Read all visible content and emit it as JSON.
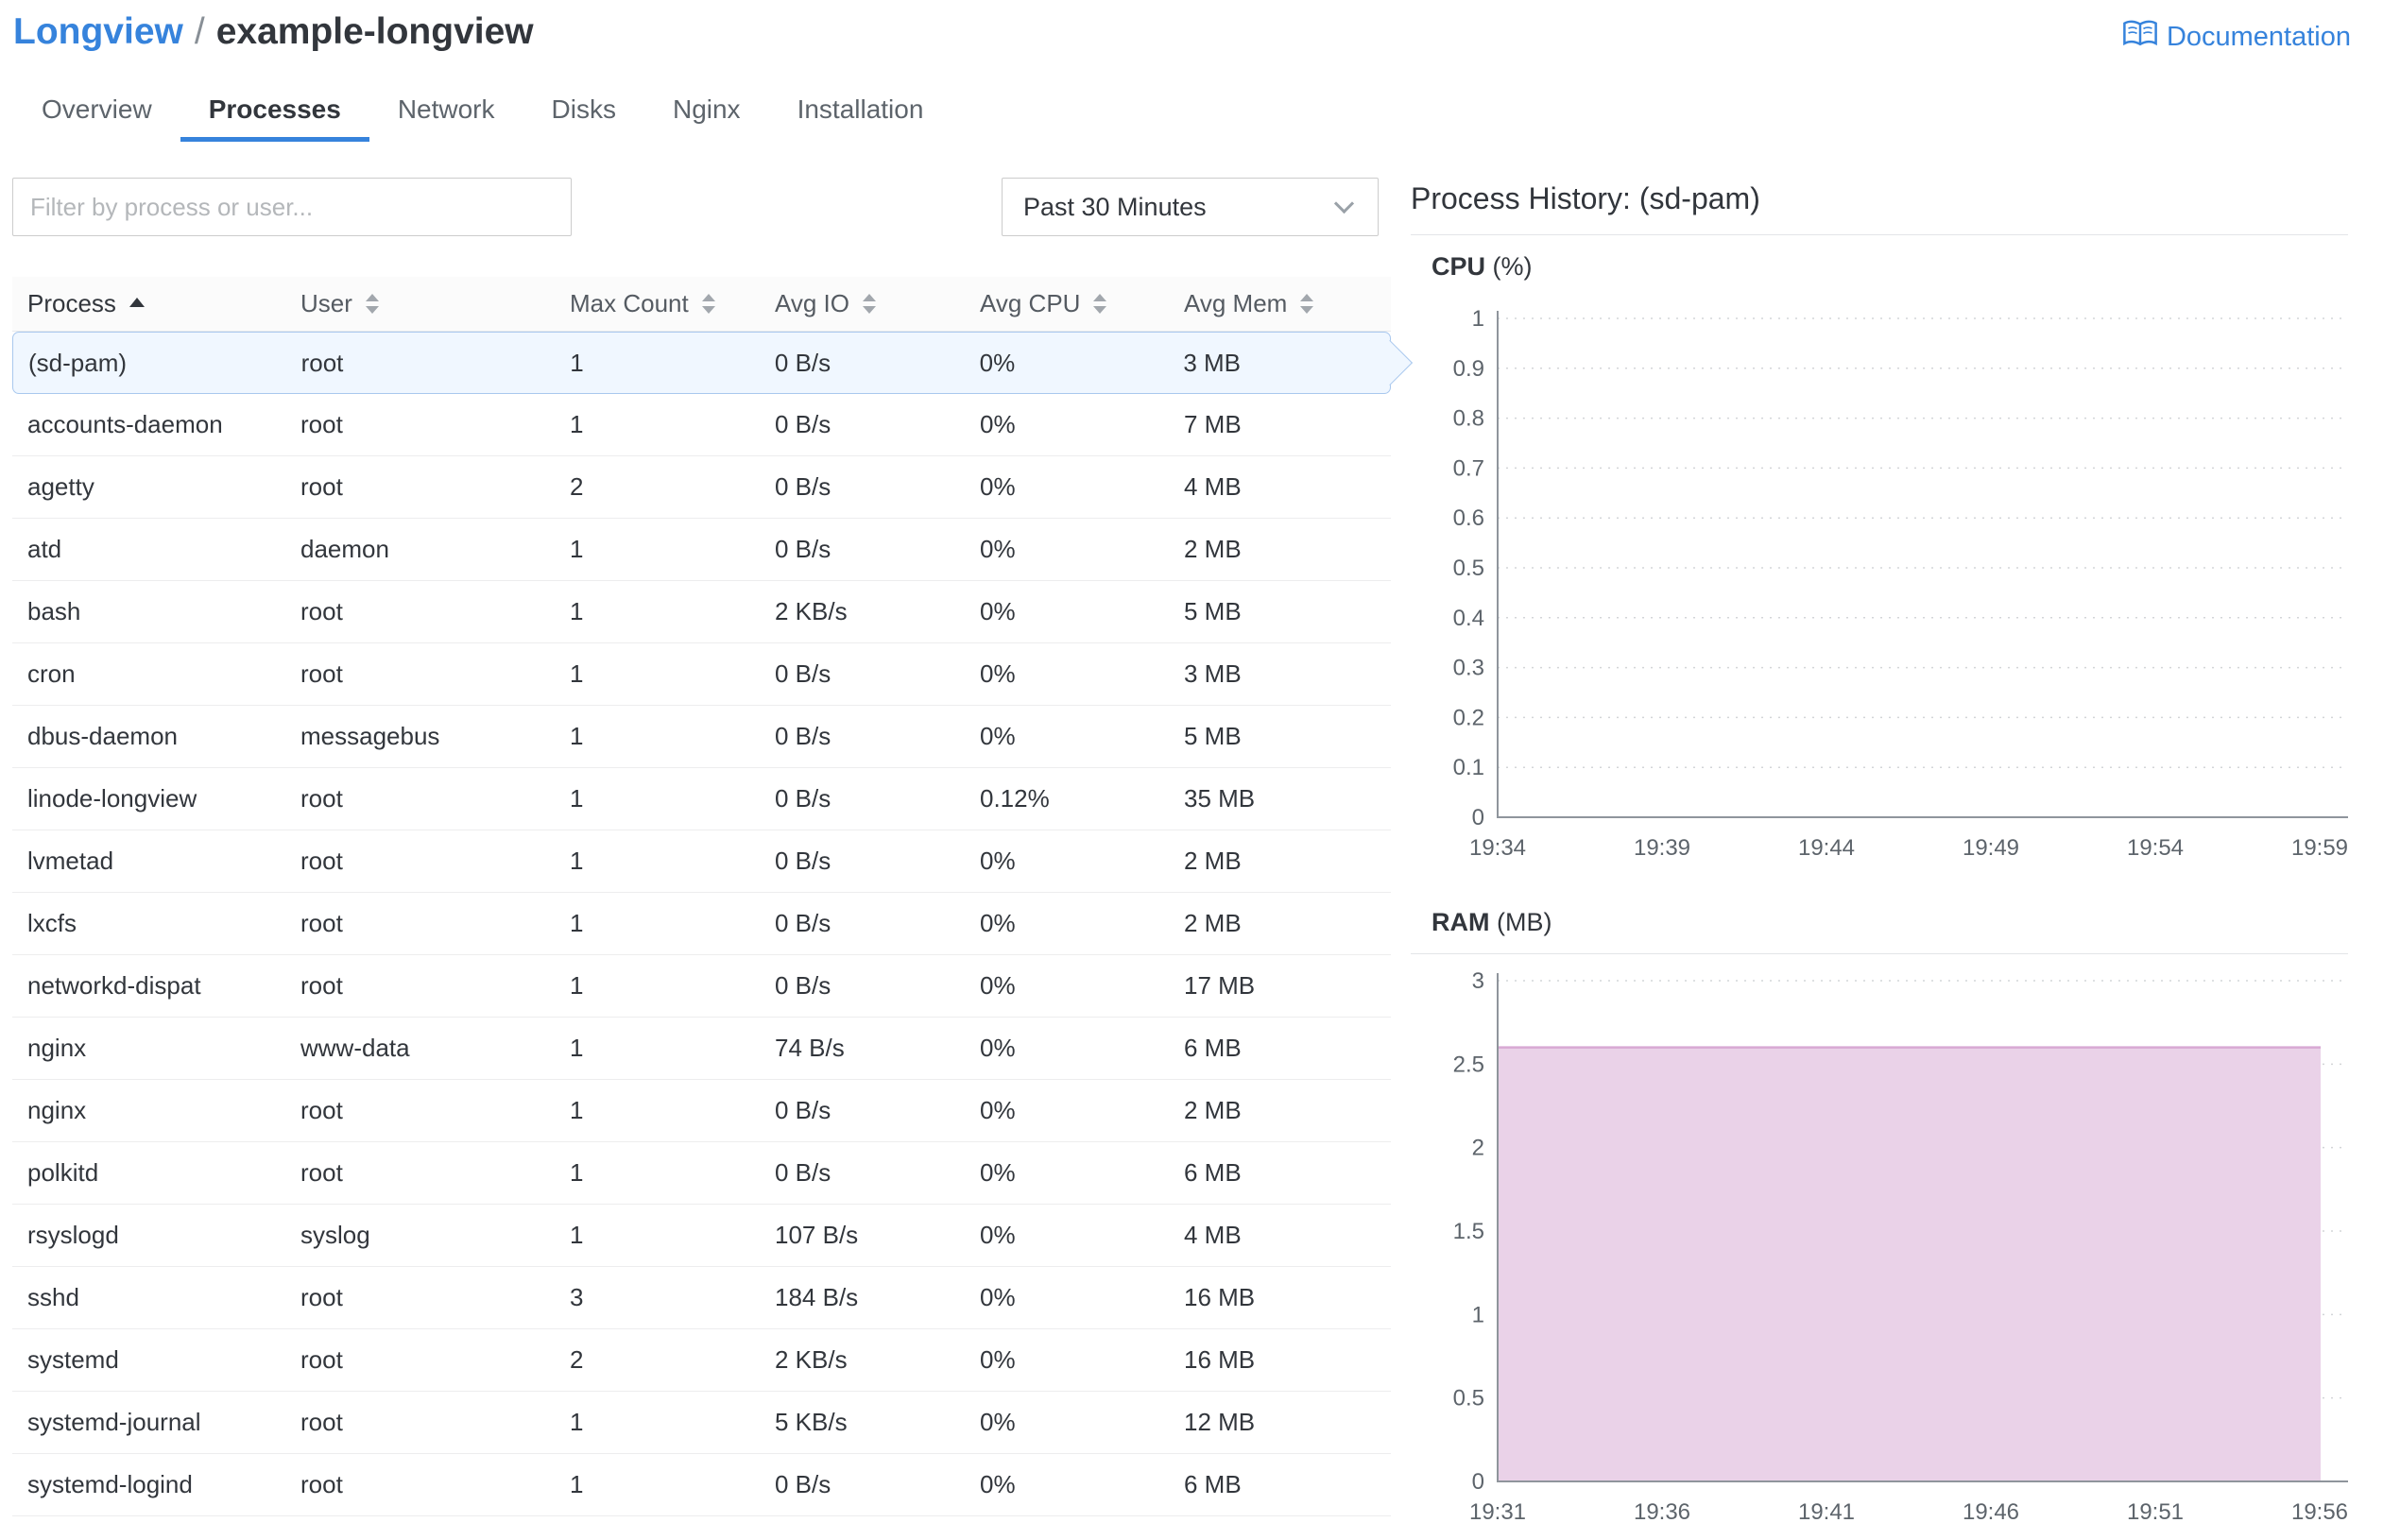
{
  "breadcrumb": {
    "parent": "Longview",
    "separator": "/",
    "current": "example-longview"
  },
  "documentation": {
    "label": "Documentation"
  },
  "tabs": [
    {
      "label": "Overview",
      "active": false
    },
    {
      "label": "Processes",
      "active": true
    },
    {
      "label": "Network",
      "active": false
    },
    {
      "label": "Disks",
      "active": false
    },
    {
      "label": "Nginx",
      "active": false
    },
    {
      "label": "Installation",
      "active": false
    }
  ],
  "filters": {
    "search_placeholder": "Filter by process or user...",
    "time_range": "Past 30 Minutes"
  },
  "table": {
    "columns": [
      "Process",
      "User",
      "Max Count",
      "Avg IO",
      "Avg CPU",
      "Avg Mem"
    ],
    "sort": {
      "column": "Process",
      "direction": "asc"
    },
    "rows": [
      {
        "process": "(sd-pam)",
        "user": "root",
        "max_count": "1",
        "avg_io": "0 B/s",
        "avg_cpu": "0%",
        "avg_mem": "3 MB",
        "selected": true
      },
      {
        "process": "accounts-daemon",
        "user": "root",
        "max_count": "1",
        "avg_io": "0 B/s",
        "avg_cpu": "0%",
        "avg_mem": "7 MB",
        "selected": false
      },
      {
        "process": "agetty",
        "user": "root",
        "max_count": "2",
        "avg_io": "0 B/s",
        "avg_cpu": "0%",
        "avg_mem": "4 MB",
        "selected": false
      },
      {
        "process": "atd",
        "user": "daemon",
        "max_count": "1",
        "avg_io": "0 B/s",
        "avg_cpu": "0%",
        "avg_mem": "2 MB",
        "selected": false
      },
      {
        "process": "bash",
        "user": "root",
        "max_count": "1",
        "avg_io": "2 KB/s",
        "avg_cpu": "0%",
        "avg_mem": "5 MB",
        "selected": false
      },
      {
        "process": "cron",
        "user": "root",
        "max_count": "1",
        "avg_io": "0 B/s",
        "avg_cpu": "0%",
        "avg_mem": "3 MB",
        "selected": false
      },
      {
        "process": "dbus-daemon",
        "user": "messagebus",
        "max_count": "1",
        "avg_io": "0 B/s",
        "avg_cpu": "0%",
        "avg_mem": "5 MB",
        "selected": false
      },
      {
        "process": "linode-longview",
        "user": "root",
        "max_count": "1",
        "avg_io": "0 B/s",
        "avg_cpu": "0.12%",
        "avg_mem": "35 MB",
        "selected": false
      },
      {
        "process": "lvmetad",
        "user": "root",
        "max_count": "1",
        "avg_io": "0 B/s",
        "avg_cpu": "0%",
        "avg_mem": "2 MB",
        "selected": false
      },
      {
        "process": "lxcfs",
        "user": "root",
        "max_count": "1",
        "avg_io": "0 B/s",
        "avg_cpu": "0%",
        "avg_mem": "2 MB",
        "selected": false
      },
      {
        "process": "networkd-dispat",
        "user": "root",
        "max_count": "1",
        "avg_io": "0 B/s",
        "avg_cpu": "0%",
        "avg_mem": "17 MB",
        "selected": false
      },
      {
        "process": "nginx",
        "user": "www-data",
        "max_count": "1",
        "avg_io": "74 B/s",
        "avg_cpu": "0%",
        "avg_mem": "6 MB",
        "selected": false
      },
      {
        "process": "nginx",
        "user": "root",
        "max_count": "1",
        "avg_io": "0 B/s",
        "avg_cpu": "0%",
        "avg_mem": "2 MB",
        "selected": false
      },
      {
        "process": "polkitd",
        "user": "root",
        "max_count": "1",
        "avg_io": "0 B/s",
        "avg_cpu": "0%",
        "avg_mem": "6 MB",
        "selected": false
      },
      {
        "process": "rsyslogd",
        "user": "syslog",
        "max_count": "1",
        "avg_io": "107 B/s",
        "avg_cpu": "0%",
        "avg_mem": "4 MB",
        "selected": false
      },
      {
        "process": "sshd",
        "user": "root",
        "max_count": "3",
        "avg_io": "184 B/s",
        "avg_cpu": "0%",
        "avg_mem": "16 MB",
        "selected": false
      },
      {
        "process": "systemd",
        "user": "root",
        "max_count": "2",
        "avg_io": "2 KB/s",
        "avg_cpu": "0%",
        "avg_mem": "16 MB",
        "selected": false
      },
      {
        "process": "systemd-journal",
        "user": "root",
        "max_count": "1",
        "avg_io": "5 KB/s",
        "avg_cpu": "0%",
        "avg_mem": "12 MB",
        "selected": false
      },
      {
        "process": "systemd-logind",
        "user": "root",
        "max_count": "1",
        "avg_io": "0 B/s",
        "avg_cpu": "0%",
        "avg_mem": "6 MB",
        "selected": false
      }
    ]
  },
  "history": {
    "title": "Process History: (sd-pam)"
  },
  "chart_data": [
    {
      "type": "line",
      "title": "CPU (%)",
      "title_bold": "CPU",
      "title_rest": "(%)",
      "x": [
        "19:34",
        "19:39",
        "19:44",
        "19:49",
        "19:54",
        "19:59"
      ],
      "values": [
        0,
        0,
        0,
        0,
        0,
        0
      ],
      "ylim": [
        0,
        1
      ],
      "yticks": [
        0,
        0.1,
        0.2,
        0.3,
        0.4,
        0.5,
        0.6,
        0.7,
        0.8,
        0.9,
        1
      ],
      "grid": "dashed-horizontal",
      "legend": "none"
    },
    {
      "type": "area",
      "title": "RAM (MB)",
      "title_bold": "RAM",
      "title_rest": "(MB)",
      "x": [
        "19:31",
        "19:36",
        "19:41",
        "19:46",
        "19:51",
        "19:56"
      ],
      "values": [
        2.6,
        2.6,
        2.6,
        2.6,
        2.6,
        2.6
      ],
      "ylim": [
        0,
        3
      ],
      "yticks": [
        0,
        0.5,
        1,
        1.5,
        2,
        2.5,
        3
      ],
      "fill_color": "#ead2e8",
      "stroke_color": "#d8a9d3",
      "grid": "dashed-horizontal",
      "legend": "none"
    }
  ],
  "colors": {
    "accent": "#3683dc",
    "selected_row_bg": "#f0f7ff",
    "selected_row_border": "#a9c8ee"
  }
}
